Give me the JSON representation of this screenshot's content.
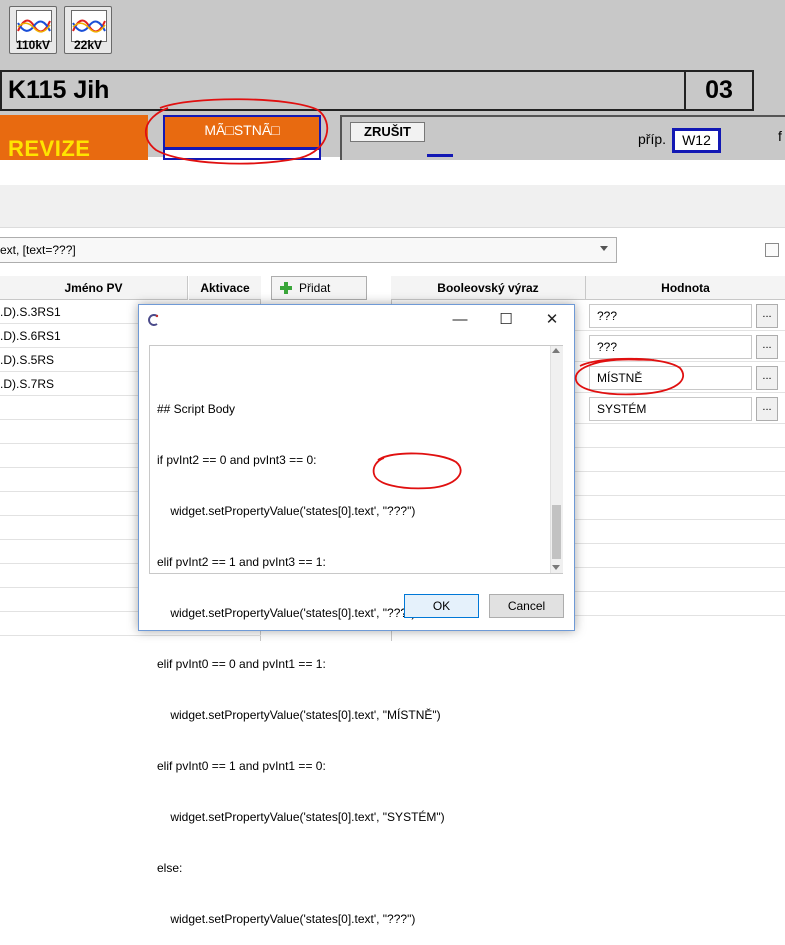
{
  "toolbar": {
    "buttons": [
      {
        "label": "110kV",
        "icon": "waveform-icon"
      },
      {
        "label": "22kV",
        "icon": "waveform-icon"
      }
    ]
  },
  "hmi": {
    "title": "K115 Jih",
    "number": "03",
    "revize_label": "REVIZE",
    "mistne_label": "MÃ□STNÃ□",
    "zrusit_label": "ZRUŠIT",
    "prip_label": "příp.",
    "prip_value": "W12",
    "right_fragment": "f"
  },
  "editor": {
    "combo_text": "ext, [text=???]",
    "left_table": {
      "headers": [
        "Jméno PV",
        "Aktivace"
      ],
      "rows": [
        ".D).S.3RS1",
        ".D).S.6RS1",
        ".D).S.5RS",
        ".D).S.7RS"
      ]
    },
    "add_button_label": "Přidat",
    "right_table": {
      "headers": [
        "Booleovský výraz",
        "Hodnota"
      ],
      "values": [
        "???",
        "???",
        "MÍSTNĚ",
        "SYSTÉM"
      ],
      "dots_label": "..."
    }
  },
  "dialog": {
    "title_icon": "c-logo-icon",
    "controls": {
      "minimize": "—",
      "maximize": "☐",
      "close": "✕"
    },
    "script_lines": [
      "## Script Body",
      "if pvInt2 == 0 and pvInt3 == 0:",
      "    widget.setPropertyValue('states[0].text', \"???\")",
      "elif pvInt2 == 1 and pvInt3 == 1:",
      "    widget.setPropertyValue('states[0].text', \"???\")",
      "elif pvInt0 == 0 and pvInt1 == 1:",
      "    widget.setPropertyValue('states[0].text', \"MÍSTNĚ\")",
      "elif pvInt0 == 1 and pvInt1 == 0:",
      "    widget.setPropertyValue('states[0].text', \"SYSTÉM\")",
      "else:",
      "    widget.setPropertyValue('states[0].text', \"???\")"
    ],
    "ok_label": "OK",
    "cancel_label": "Cancel"
  },
  "colors": {
    "revize_bg": "#e86a10",
    "revize_text": "#ffe400",
    "highlight_blue": "#1218b4",
    "annotation_red": "#e01010",
    "hmi_grey": "#c8c8c8"
  }
}
